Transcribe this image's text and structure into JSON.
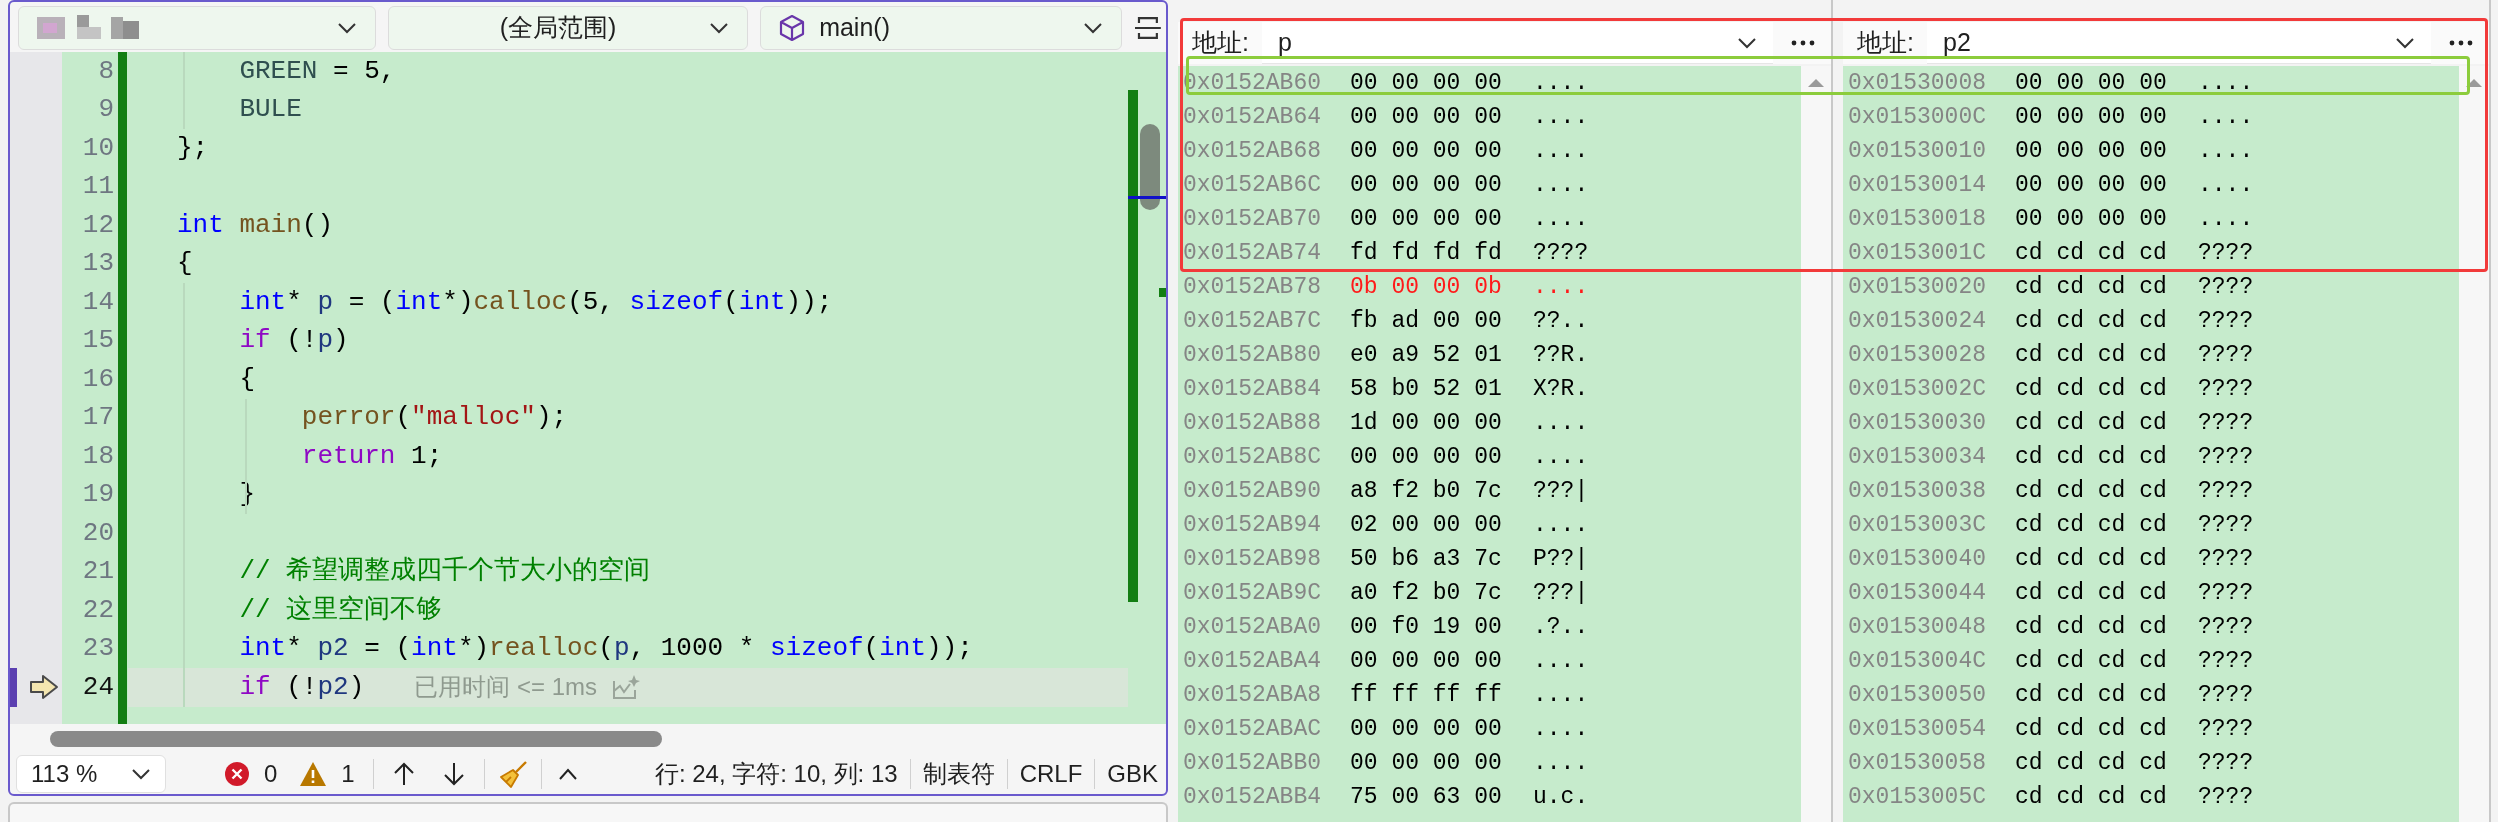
{
  "editor": {
    "dropdowns": [
      {
        "kind": "redacted"
      },
      {
        "kind": "scope",
        "text": "(全局范围)"
      },
      {
        "kind": "function",
        "text": "main()"
      }
    ],
    "lines": [
      {
        "number": "8",
        "current": false,
        "tokens": [
          {
            "kind": "enum",
            "text": "    GREEN"
          },
          {
            "kind": "plain",
            "text": " = 5,"
          }
        ]
      },
      {
        "number": "9",
        "current": false,
        "tokens": [
          {
            "kind": "enum",
            "text": "    BULE"
          }
        ]
      },
      {
        "number": "10",
        "current": false,
        "tokens": [
          {
            "kind": "plain",
            "text": "};"
          }
        ]
      },
      {
        "number": "11",
        "current": false
      },
      {
        "number": "12",
        "current": false,
        "tokens": [
          {
            "kind": "keyword",
            "text": "int"
          },
          {
            "kind": "function",
            "text": " main"
          },
          {
            "kind": "plain",
            "text": "()"
          }
        ]
      },
      {
        "number": "13",
        "current": false,
        "tokens": [
          {
            "kind": "plain",
            "text": "{"
          }
        ]
      },
      {
        "number": "14",
        "current": false,
        "tokens": [
          {
            "kind": "keyword",
            "text": "    int"
          },
          {
            "kind": "plain",
            "text": "* "
          },
          {
            "kind": "variable",
            "text": "p"
          },
          {
            "kind": "plain",
            "text": " = ("
          },
          {
            "kind": "keyword",
            "text": "int"
          },
          {
            "kind": "plain",
            "text": "*)"
          },
          {
            "kind": "function",
            "text": "calloc"
          },
          {
            "kind": "plain",
            "text": "(5, "
          },
          {
            "kind": "keyword",
            "text": "sizeof"
          },
          {
            "kind": "plain",
            "text": "("
          },
          {
            "kind": "keyword",
            "text": "int"
          },
          {
            "kind": "plain",
            "text": "));"
          }
        ]
      },
      {
        "number": "15",
        "current": false,
        "tokens": [
          {
            "kind": "control",
            "text": "    if"
          },
          {
            "kind": "plain",
            "text": " (!"
          },
          {
            "kind": "variable",
            "text": "p"
          },
          {
            "kind": "plain",
            "text": ")"
          }
        ]
      },
      {
        "number": "16",
        "current": false,
        "tokens": [
          {
            "kind": "plain",
            "text": "    {"
          }
        ]
      },
      {
        "number": "17",
        "current": false,
        "tokens": [
          {
            "kind": "function",
            "text": "        perror"
          },
          {
            "kind": "plain",
            "text": "("
          },
          {
            "kind": "string",
            "text": "\"malloc\""
          },
          {
            "kind": "plain",
            "text": ");"
          }
        ]
      },
      {
        "number": "18",
        "current": false,
        "tokens": [
          {
            "kind": "control",
            "text": "        return"
          },
          {
            "kind": "plain",
            "text": " 1;"
          }
        ]
      },
      {
        "number": "19",
        "current": false,
        "tokens": [
          {
            "kind": "plain",
            "text": "    }"
          }
        ]
      },
      {
        "number": "20",
        "current": false
      },
      {
        "number": "21",
        "current": false,
        "tokens": [
          {
            "kind": "comment",
            "text": "    // 希望调整成四千个节大小的空间"
          }
        ]
      },
      {
        "number": "22",
        "current": false,
        "tokens": [
          {
            "kind": "comment",
            "text": "    // 这里空间不够"
          }
        ]
      },
      {
        "number": "23",
        "current": false,
        "tokens": [
          {
            "kind": "keyword",
            "text": "    int"
          },
          {
            "kind": "plain",
            "text": "* "
          },
          {
            "kind": "variable",
            "text": "p2"
          },
          {
            "kind": "plain",
            "text": " = ("
          },
          {
            "kind": "keyword",
            "text": "int"
          },
          {
            "kind": "plain",
            "text": "*)"
          },
          {
            "kind": "function",
            "text": "realloc"
          },
          {
            "kind": "plain",
            "text": "("
          },
          {
            "kind": "variable",
            "text": "p"
          },
          {
            "kind": "plain",
            "text": ", 1000 * "
          },
          {
            "kind": "keyword",
            "text": "sizeof"
          },
          {
            "kind": "plain",
            "text": "("
          },
          {
            "kind": "keyword",
            "text": "int"
          },
          {
            "kind": "plain",
            "text": "));"
          }
        ]
      },
      {
        "number": "24",
        "current": true,
        "hint": "已用时间 <= 1ms",
        "tokens": [
          {
            "kind": "control",
            "text": "    if"
          },
          {
            "kind": "plain",
            "text": " (!"
          },
          {
            "kind": "variable",
            "text": "p2"
          },
          {
            "kind": "plain",
            "text": ")"
          }
        ]
      }
    ],
    "status_bar": {
      "zoom": "113 %",
      "errors": "0",
      "warnings": "1",
      "position": "行: 24, 字符: 10, 列: 13",
      "indentation": "制表符",
      "line_endings": "CRLF",
      "encoding": "GBK"
    }
  },
  "memory_panels": [
    {
      "address_label": "地址:",
      "expression": "p",
      "rows": [
        {
          "address": "0x0152AB60",
          "bytes": "00 00 00 00",
          "ascii": "....",
          "changed": false
        },
        {
          "address": "0x0152AB64",
          "bytes": "00 00 00 00",
          "ascii": "....",
          "changed": false
        },
        {
          "address": "0x0152AB68",
          "bytes": "00 00 00 00",
          "ascii": "....",
          "changed": false
        },
        {
          "address": "0x0152AB6C",
          "bytes": "00 00 00 00",
          "ascii": "....",
          "changed": false
        },
        {
          "address": "0x0152AB70",
          "bytes": "00 00 00 00",
          "ascii": "....",
          "changed": false
        },
        {
          "address": "0x0152AB74",
          "bytes": "fd fd fd fd",
          "ascii": "????",
          "changed": false
        },
        {
          "address": "0x0152AB78",
          "bytes": "0b 00 00 0b",
          "ascii": "....",
          "changed": true
        },
        {
          "address": "0x0152AB7C",
          "bytes": "fb ad 00 00",
          "ascii": "??..",
          "changed": false
        },
        {
          "address": "0x0152AB80",
          "bytes": "e0 a9 52 01",
          "ascii": "??R.",
          "changed": false
        },
        {
          "address": "0x0152AB84",
          "bytes": "58 b0 52 01",
          "ascii": "X?R.",
          "changed": false
        },
        {
          "address": "0x0152AB88",
          "bytes": "1d 00 00 00",
          "ascii": "....",
          "changed": false
        },
        {
          "address": "0x0152AB8C",
          "bytes": "00 00 00 00",
          "ascii": "....",
          "changed": false
        },
        {
          "address": "0x0152AB90",
          "bytes": "a8 f2 b0 7c",
          "ascii": "???|",
          "changed": false
        },
        {
          "address": "0x0152AB94",
          "bytes": "02 00 00 00",
          "ascii": "....",
          "changed": false
        },
        {
          "address": "0x0152AB98",
          "bytes": "50 b6 a3 7c",
          "ascii": "P??|",
          "changed": false
        },
        {
          "address": "0x0152AB9C",
          "bytes": "a0 f2 b0 7c",
          "ascii": "???|",
          "changed": false
        },
        {
          "address": "0x0152ABA0",
          "bytes": "00 f0 19 00",
          "ascii": ".?..",
          "changed": false
        },
        {
          "address": "0x0152ABA4",
          "bytes": "00 00 00 00",
          "ascii": "....",
          "changed": false
        },
        {
          "address": "0x0152ABA8",
          "bytes": "ff ff ff ff",
          "ascii": "....",
          "changed": false
        },
        {
          "address": "0x0152ABAC",
          "bytes": "00 00 00 00",
          "ascii": "....",
          "changed": false
        },
        {
          "address": "0x0152ABB0",
          "bytes": "00 00 00 00",
          "ascii": "....",
          "changed": false
        },
        {
          "address": "0x0152ABB4",
          "bytes": "75 00 63 00",
          "ascii": "u.c.",
          "changed": false
        }
      ]
    },
    {
      "address_label": "地址:",
      "expression": "p2",
      "rows": [
        {
          "address": "0x01530008",
          "bytes": "00 00 00 00",
          "ascii": "....",
          "changed": false
        },
        {
          "address": "0x0153000C",
          "bytes": "00 00 00 00",
          "ascii": "....",
          "changed": false
        },
        {
          "address": "0x01530010",
          "bytes": "00 00 00 00",
          "ascii": "....",
          "changed": false
        },
        {
          "address": "0x01530014",
          "bytes": "00 00 00 00",
          "ascii": "....",
          "changed": false
        },
        {
          "address": "0x01530018",
          "bytes": "00 00 00 00",
          "ascii": "....",
          "changed": false
        },
        {
          "address": "0x0153001C",
          "bytes": "cd cd cd cd",
          "ascii": "????",
          "changed": false
        },
        {
          "address": "0x01530020",
          "bytes": "cd cd cd cd",
          "ascii": "????",
          "changed": false
        },
        {
          "address": "0x01530024",
          "bytes": "cd cd cd cd",
          "ascii": "????",
          "changed": false
        },
        {
          "address": "0x01530028",
          "bytes": "cd cd cd cd",
          "ascii": "????",
          "changed": false
        },
        {
          "address": "0x0153002C",
          "bytes": "cd cd cd cd",
          "ascii": "????",
          "changed": false
        },
        {
          "address": "0x01530030",
          "bytes": "cd cd cd cd",
          "ascii": "????",
          "changed": false
        },
        {
          "address": "0x01530034",
          "bytes": "cd cd cd cd",
          "ascii": "????",
          "changed": false
        },
        {
          "address": "0x01530038",
          "bytes": "cd cd cd cd",
          "ascii": "????",
          "changed": false
        },
        {
          "address": "0x0153003C",
          "bytes": "cd cd cd cd",
          "ascii": "????",
          "changed": false
        },
        {
          "address": "0x01530040",
          "bytes": "cd cd cd cd",
          "ascii": "????",
          "changed": false
        },
        {
          "address": "0x01530044",
          "bytes": "cd cd cd cd",
          "ascii": "????",
          "changed": false
        },
        {
          "address": "0x01530048",
          "bytes": "cd cd cd cd",
          "ascii": "????",
          "changed": false
        },
        {
          "address": "0x0153004C",
          "bytes": "cd cd cd cd",
          "ascii": "????",
          "changed": false
        },
        {
          "address": "0x01530050",
          "bytes": "cd cd cd cd",
          "ascii": "????",
          "changed": false
        },
        {
          "address": "0x01530054",
          "bytes": "cd cd cd cd",
          "ascii": "????",
          "changed": false
        },
        {
          "address": "0x01530058",
          "bytes": "cd cd cd cd",
          "ascii": "????",
          "changed": false
        },
        {
          "address": "0x0153005C",
          "bytes": "cd cd cd cd",
          "ascii": "????",
          "changed": false
        }
      ]
    }
  ],
  "annotations": [
    {
      "color": "#f23a3a"
    },
    {
      "color": "#8ccc3c"
    }
  ]
}
